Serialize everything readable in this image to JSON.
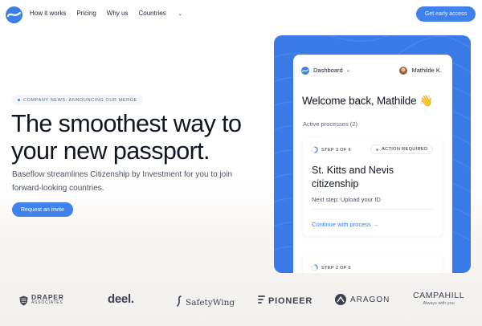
{
  "nav": {
    "logo_icon": "baseflow-logo-icon",
    "links": [
      "How it works",
      "Pricing",
      "Why us",
      "Countries"
    ],
    "cta_label": "Get early access"
  },
  "hero": {
    "badge": "COMPANY NEWS: ANNOUNCING OUR MERGE",
    "title_line1": "The smoothest way to",
    "title_line2": "your new passport.",
    "subtitle": "Baseflow streamlines Citizenship by Investment for you to join forward-looking countries.",
    "cta_label": "Request an invite"
  },
  "dashboard": {
    "menu_label": "Dashboard",
    "user_name": "Mathilde K.",
    "welcome": "Welcome back, Mathilde 👋",
    "active_label": "Active processes (2)",
    "processes": [
      {
        "step": "STEP 3 OF 6",
        "status": "ACTION REQUIRED",
        "title": "St. Kitts and Nevis citizenship",
        "next_step": "Next step: Upload your ID",
        "link": "Continue with process →",
        "progress": 0.5
      },
      {
        "step": "STEP 2 OF 6",
        "progress": 0.33
      }
    ]
  },
  "logos": {
    "draper_line1": "DRAPER",
    "draper_line2": "ASSOCIATES",
    "deel": "deel.",
    "safetywing": "SafetyWing",
    "pioneer": "PIONEER",
    "aragon": "ARAGON",
    "campahill_line1": "CAMPAHILL",
    "campahill_line2": "Always with you"
  },
  "colors": {
    "accent": "#3f82ec",
    "panel": "#3a7ae6",
    "text": "#0f1522"
  }
}
